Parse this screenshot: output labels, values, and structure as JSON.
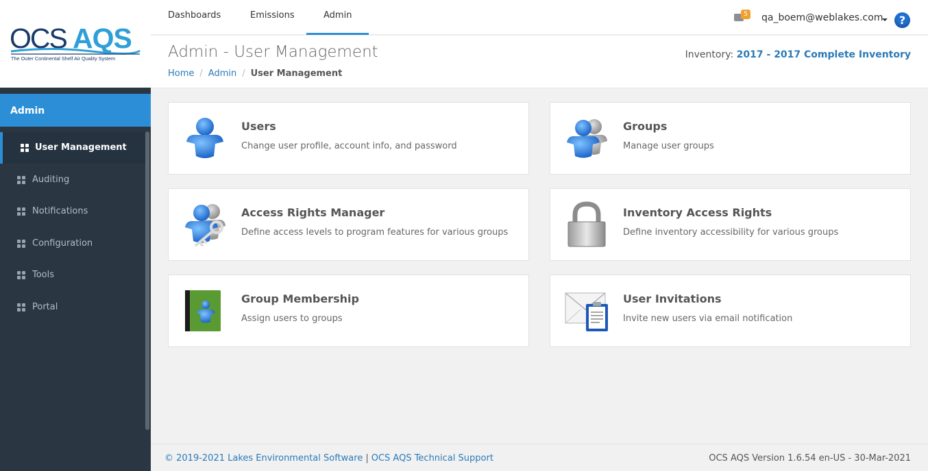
{
  "brand": {
    "logo_text_1": "OCS",
    "logo_text_2": "AQS",
    "tagline": "The Outer Continental Shelf Air Quality System",
    "colors": {
      "dark_navy": "#1a3a6b",
      "teal": "#2f9fd7"
    }
  },
  "sidebar": {
    "section_title": "Admin",
    "items": [
      {
        "label": "User Management",
        "active": true
      },
      {
        "label": "Auditing",
        "active": false
      },
      {
        "label": "Notifications",
        "active": false
      },
      {
        "label": "Configuration",
        "active": false
      },
      {
        "label": "Tools",
        "active": false
      },
      {
        "label": "Portal",
        "active": false
      }
    ]
  },
  "header": {
    "tabs": [
      {
        "label": "Dashboards",
        "active": false
      },
      {
        "label": "Emissions",
        "active": false
      },
      {
        "label": "Admin",
        "active": true
      }
    ],
    "mail_count": "5",
    "user_email": "qa_boem@weblakes.com",
    "help_symbol": "?"
  },
  "titlebar": {
    "title": "Admin - User Management",
    "inventory_label": "Inventory:",
    "inventory_value": "2017 - 2017 Complete Inventory",
    "breadcrumb": [
      "Home",
      "Admin",
      "User Management"
    ],
    "breadcrumb_sep": "/"
  },
  "cards": [
    {
      "title": "Users",
      "description": "Change user profile, account info, and password",
      "icon": "user-icon"
    },
    {
      "title": "Groups",
      "description": "Manage user groups",
      "icon": "groups-icon"
    },
    {
      "title": "Access Rights Manager",
      "description": "Define access levels to program features for various groups",
      "icon": "user-key-icon"
    },
    {
      "title": "Inventory Access Rights",
      "description": "Define inventory accessibility for various groups",
      "icon": "padlock-icon"
    },
    {
      "title": "Group Membership",
      "description": "Assign users to groups",
      "icon": "address-book-icon"
    },
    {
      "title": "User Invitations",
      "description": "Invite new users via email notification",
      "icon": "email-invite-icon"
    }
  ],
  "footer": {
    "copyright": "© 2019-2021 Lakes Environmental Software",
    "divider": "|",
    "support": "OCS AQS Technical Support",
    "version": "OCS AQS Version 1.6.54 en-US - 30-Mar-2021"
  },
  "accent_color": "#2c8ed6"
}
